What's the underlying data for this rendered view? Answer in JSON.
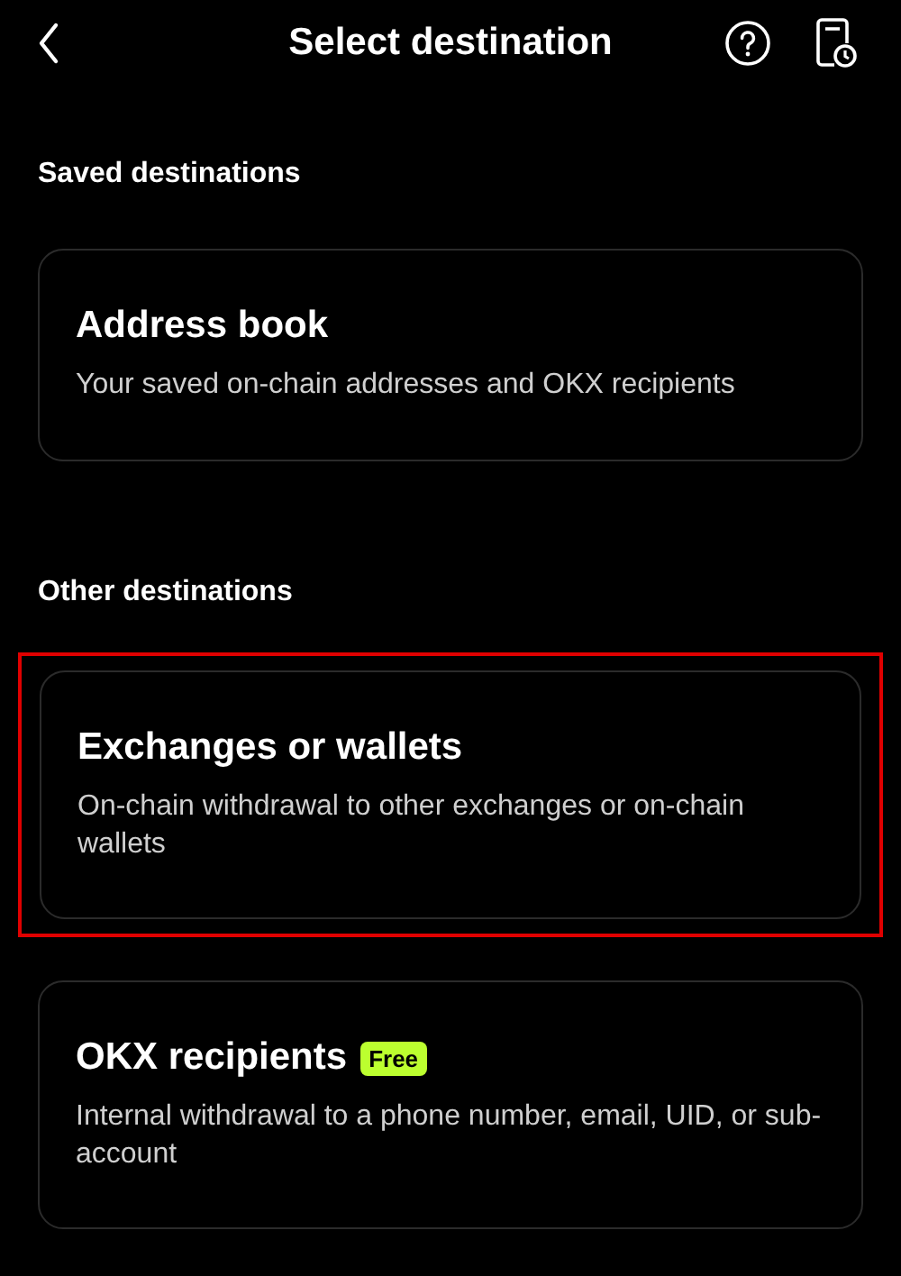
{
  "header": {
    "title": "Select destination"
  },
  "sections": [
    {
      "title": "Saved destinations",
      "cards": [
        {
          "title": "Address book",
          "description": "Your saved on-chain addresses and OKX recipients",
          "highlighted": false
        }
      ]
    },
    {
      "title": "Other destinations",
      "cards": [
        {
          "title": "Exchanges or wallets",
          "description": "On-chain withdrawal to other exchanges or on-chain wallets",
          "highlighted": true
        },
        {
          "title": "OKX recipients",
          "badge": "Free",
          "description": "Internal withdrawal to a phone number, email, UID, or sub-account",
          "highlighted": false
        }
      ]
    }
  ]
}
